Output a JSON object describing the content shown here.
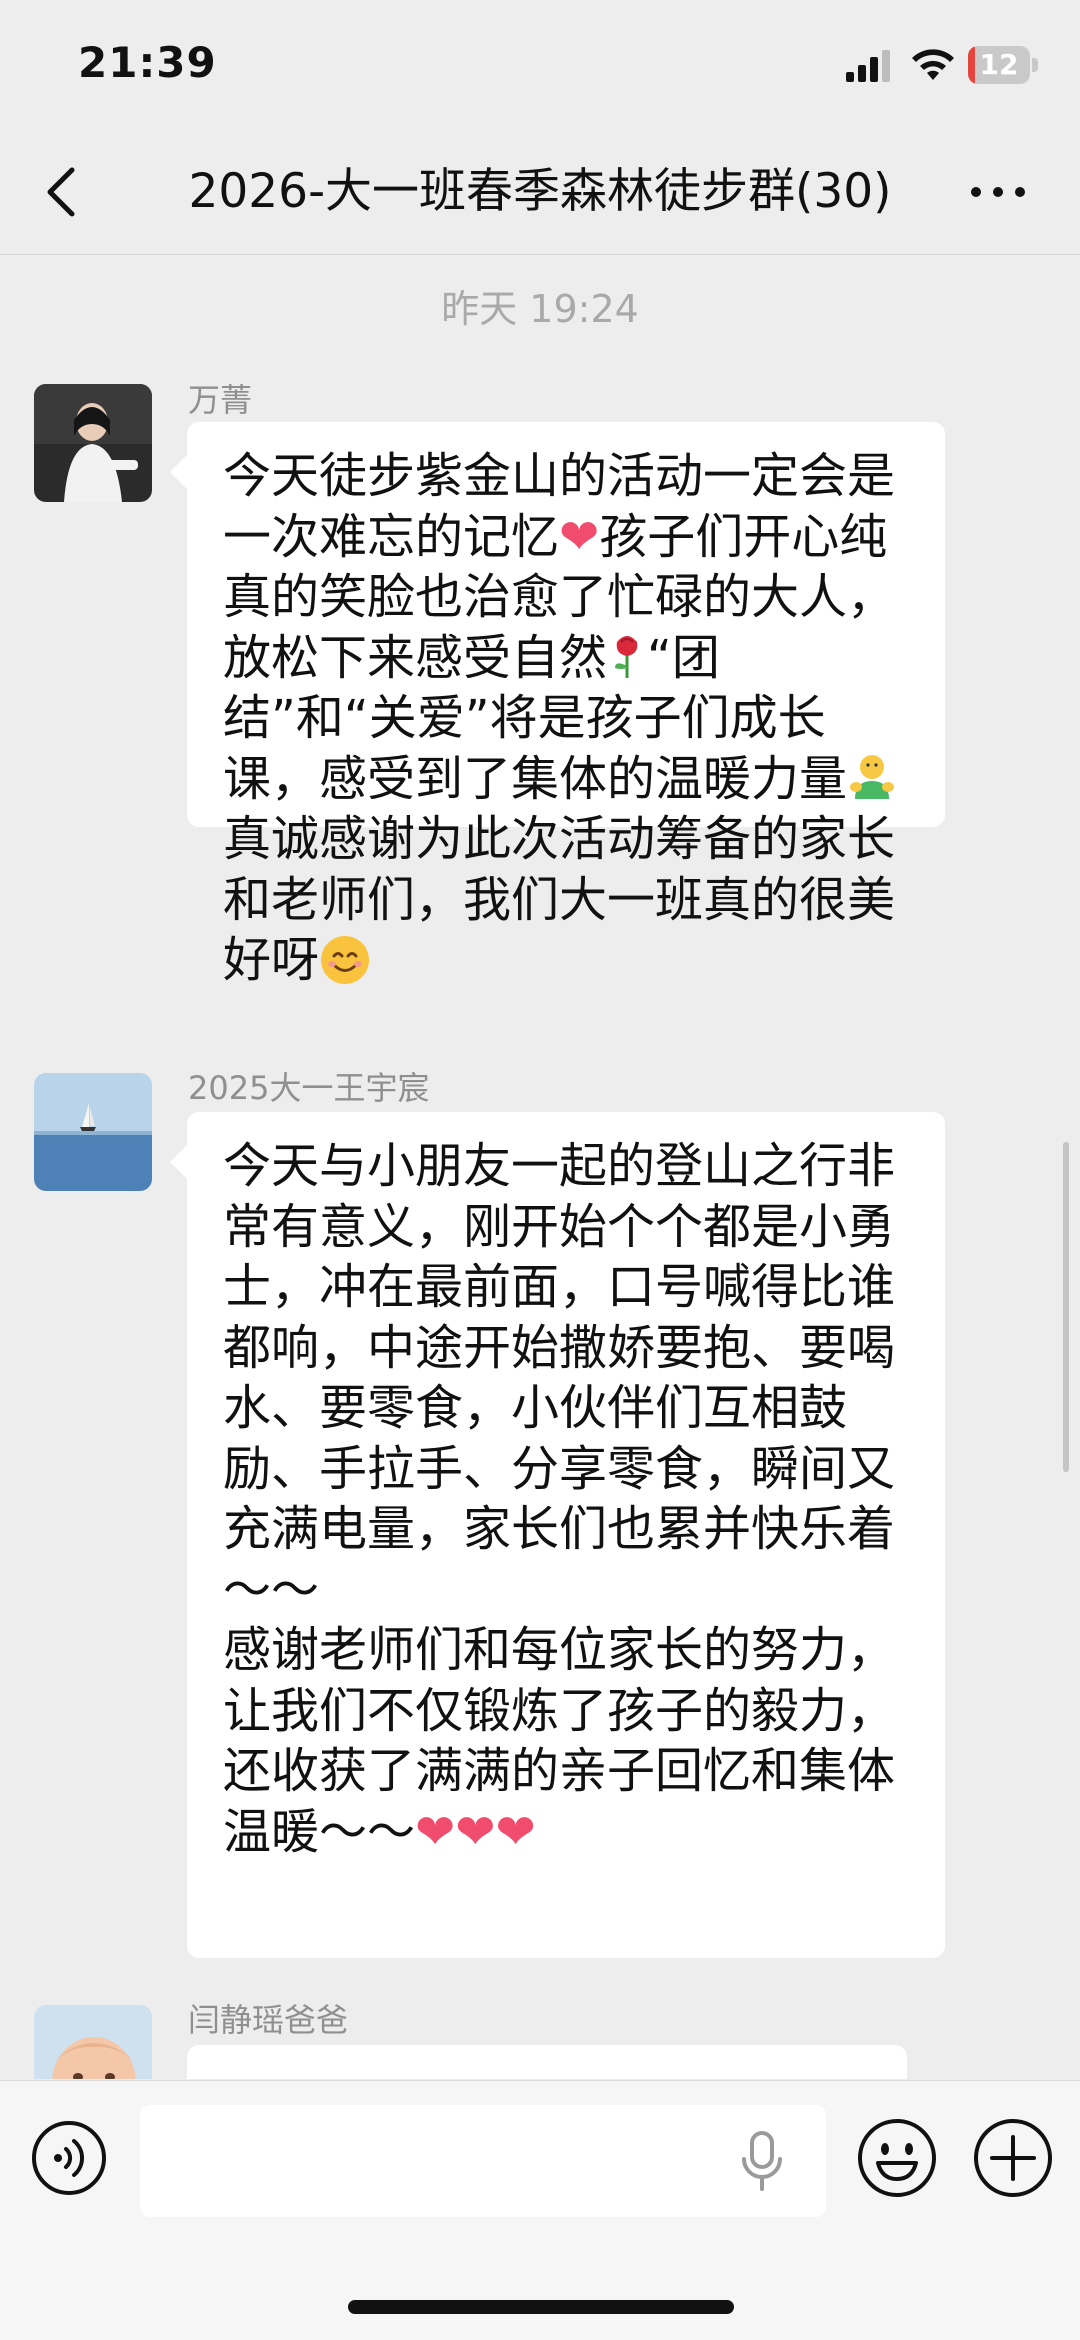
{
  "status_bar": {
    "time": "21:39",
    "battery_level": "12",
    "battery_fraction": 0.12,
    "icons": [
      "signal-icon",
      "wifi-icon",
      "battery-icon"
    ]
  },
  "header": {
    "title": "2026-大一班春季森林徒步群(30)",
    "back_icon": "chevron-left-icon",
    "more_icon": "more-icon"
  },
  "chat": {
    "timestamp": "昨天 19:24",
    "messages": [
      {
        "sender": "万菁",
        "text_1": "今天徒步紫金山的活动一定会是一次难忘的记忆",
        "text_2": "孩子们开心纯真的笑脸也治愈了忙碌的大人，放松下来感受自然",
        "text_3": "“团结”和“关爱”将是孩子们成长课，感受到了集体的温暖力量",
        "text_4": "真诚感谢为此次活动筹备的家长和老师们，我们大一班真的很美好呀"
      },
      {
        "sender": "2025大一王宇宸",
        "text": "今天与小朋友一起的登山之行非常有意义，刚开始个个都是小勇士，冲在最前面，口号喊得比谁都响，中途开始撒娇要抱、要喝水、要零食，小伙伴们互相鼓励、手拉手、分享零食，瞬间又充满电量，家长们也累并快乐着～～\n感谢老师们和每位家长的努力，让我们不仅锻炼了孩子的毅力，还收获了满满的亲子回忆和集体温暖～～"
      },
      {
        "sender": "闫静瑶爸爸"
      }
    ]
  },
  "input_bar": {
    "placeholder": "",
    "icons": [
      "voice-icon",
      "microphone-icon",
      "emoji-icon",
      "plus-icon"
    ]
  },
  "colors": {
    "background": "#ededed",
    "bubble": "#ffffff",
    "battery_red": "#e2463e",
    "heart": "#f04d6e"
  }
}
